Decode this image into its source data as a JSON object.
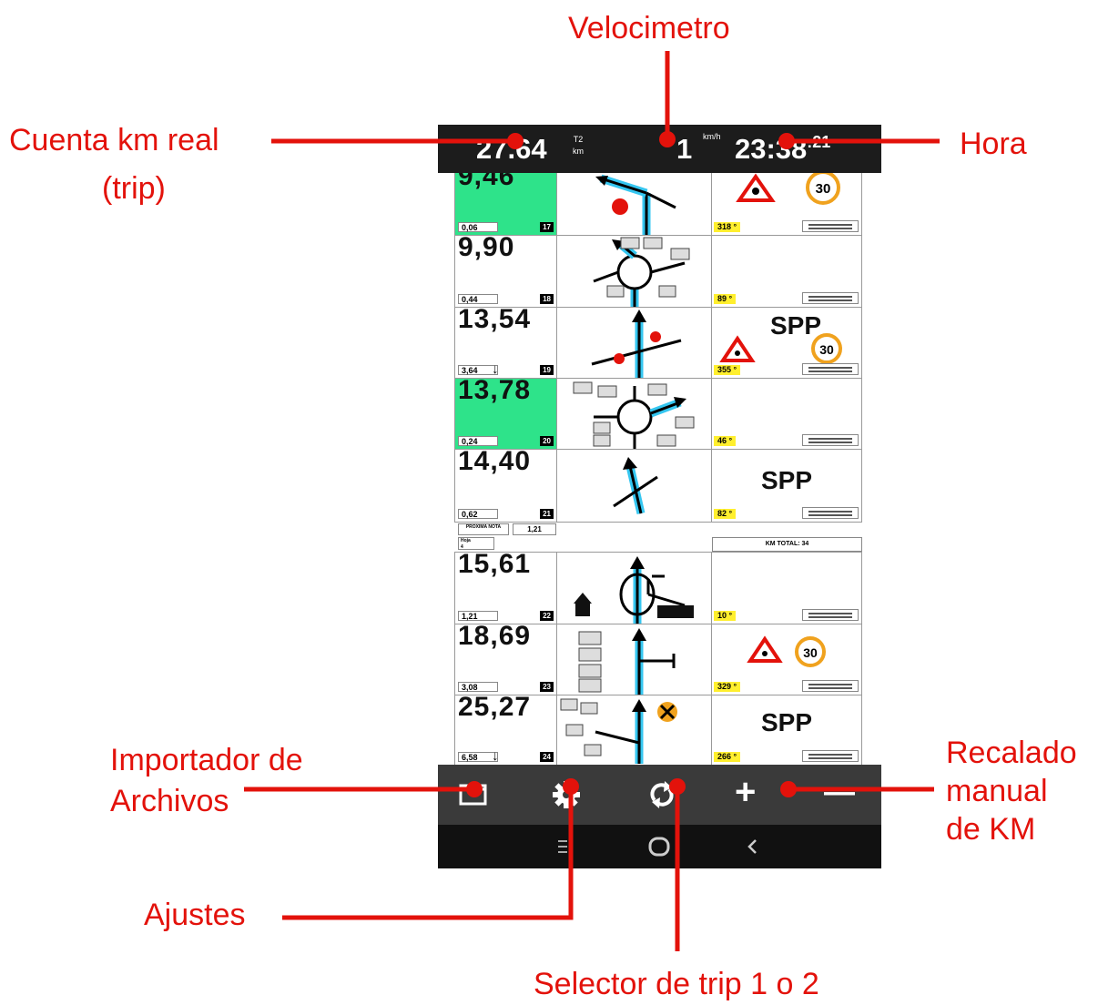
{
  "annotations": {
    "velocimetro": "Velocimetro",
    "cuenta_line1": "Cuenta km real",
    "cuenta_line2": "(trip)",
    "hora": "Hora",
    "importador_line1": "Importador de",
    "importador_line2": "Archivos",
    "recalado_line1": "Recalado",
    "recalado_line2": "manual",
    "recalado_line3": "de KM",
    "ajustes": "Ajustes",
    "selector": "Selector de trip 1 o 2"
  },
  "status": {
    "trip_km": "27.64",
    "trip_label": "T2",
    "trip_unit": "km",
    "speed": "1",
    "speed_unit": "km/h",
    "clock": "23:38",
    "clock_seconds": ":21"
  },
  "roadbook": {
    "rows": [
      {
        "km": "9,46",
        "partial": "0,06",
        "num": "17",
        "cap": "318 °",
        "spp": "",
        "down": false
      },
      {
        "km": "9,90",
        "partial": "0,44",
        "num": "18",
        "cap": "89 °",
        "spp": "",
        "down": false
      },
      {
        "km": "13,54",
        "partial": "3,64",
        "num": "19",
        "cap": "355 °",
        "spp": "SPP",
        "down": true
      },
      {
        "km": "13,78",
        "partial": "0,24",
        "num": "20",
        "cap": "46 °",
        "spp": "",
        "down": false
      },
      {
        "km": "14,40",
        "partial": "0,62",
        "num": "21",
        "cap": "82 °",
        "spp": "SPP",
        "down": false
      },
      {
        "km": "15,61",
        "partial": "1,21",
        "num": "22",
        "cap": "10 °",
        "spp": "",
        "down": false
      },
      {
        "km": "18,69",
        "partial": "3,08",
        "num": "23",
        "cap": "329 °",
        "spp": "",
        "down": false
      },
      {
        "km": "25,27",
        "partial": "6,58",
        "num": "24",
        "cap": "266 °",
        "spp": "SPP",
        "down": true
      }
    ],
    "speed_sign": "30",
    "section": {
      "next_note": "PROXIMA NOTA",
      "next_value": "1,21",
      "page_label": "Hoja",
      "page_value": "4",
      "km_total": "KM TOTAL: 34"
    }
  },
  "bottom_bar": {
    "plus": "+",
    "minus": "—"
  },
  "colors": {
    "annotation": "#e3120b",
    "highlight": "#2ee38a",
    "route": "#35c6f0",
    "cap_badge": "#ffef2e"
  }
}
